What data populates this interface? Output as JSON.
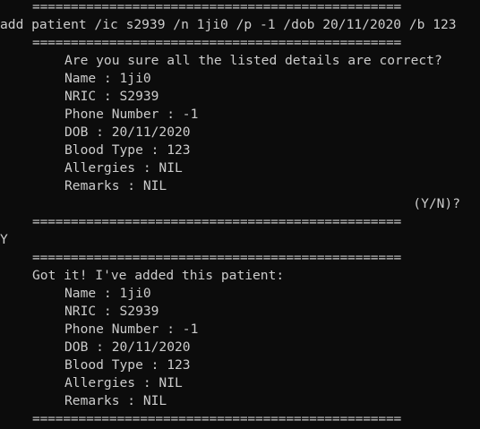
{
  "window": {
    "background": "#0c0c0c",
    "foreground": "#cccccc"
  },
  "terminal": {
    "separator": "================================================",
    "command_line": "add patient /ic s2939 /n 1ji0 /p -1 /dob 20/11/2020 /b 123",
    "confirm_block": {
      "question": "Are you sure all the listed details are correct?",
      "details": [
        "Name : 1ji0",
        "NRIC : S2939",
        "Phone Number : -1",
        "DOB : 20/11/2020",
        "Blood Type : 123",
        "Allergies : NIL",
        "Remarks : NIL"
      ],
      "prompt": "(Y/N)?"
    },
    "user_response": "Y",
    "result_block": {
      "message": "Got it! I've added this patient:",
      "details": [
        "Name : 1ji0",
        "NRIC : S2939",
        "Phone Number : -1",
        "DOB : 20/11/2020",
        "Blood Type : 123",
        "Allergies : NIL",
        "Remarks : NIL"
      ]
    }
  }
}
